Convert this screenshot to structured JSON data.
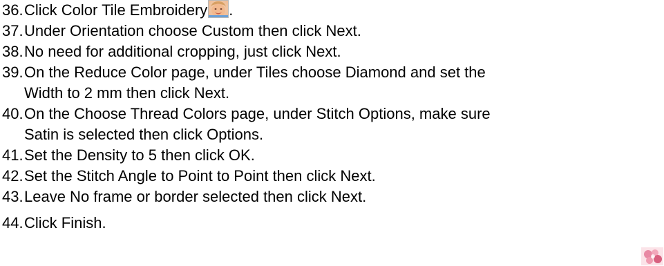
{
  "steps": [
    {
      "num": "36.",
      "text": "Click Color Tile Embroidery",
      "suffix": ".",
      "icon": "child-photo-icon"
    },
    {
      "num": "37.",
      "text": "Under Orientation choose Custom then click Next."
    },
    {
      "num": "38.",
      "text": "No need for additional cropping, just click Next."
    },
    {
      "num": "39.",
      "text": "On the Reduce Color page, under Tiles choose Diamond and set the",
      "text2": "Width to 2 mm then click Next."
    },
    {
      "num": "40.",
      "text": "On the Choose Thread Colors page, under Stitch Options, make sure",
      "text2": "Satin is selected then click Options."
    },
    {
      "num": "41.",
      "text": "Set the Density to 5 then click OK."
    },
    {
      "num": "42.",
      "text": "Set the Stitch Angle to Point to Point then click Next."
    },
    {
      "num": "43.",
      "text": "Leave No frame or border selected then click Next."
    },
    {
      "num": "44.",
      "text": "Click Finish."
    }
  ],
  "icons": {
    "tile": "child-photo-icon",
    "corner": "flower-photo-icon"
  }
}
